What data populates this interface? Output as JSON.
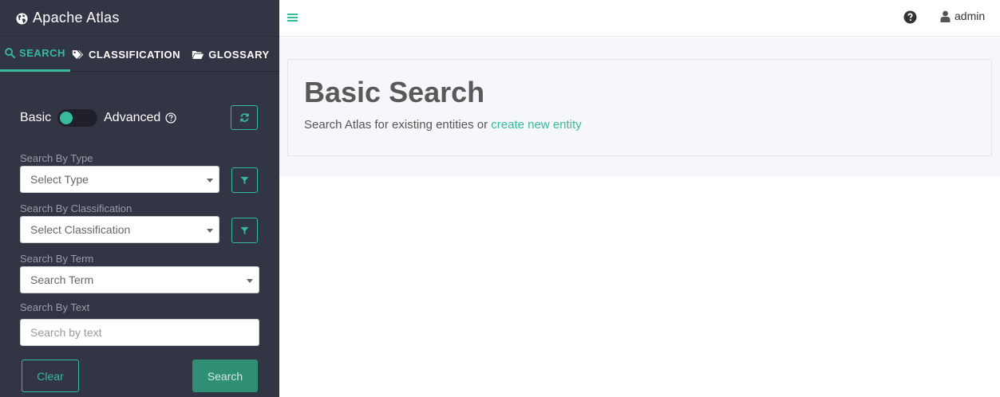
{
  "brand": {
    "title": "Apache Atlas"
  },
  "tabs": [
    {
      "label": "SEARCH",
      "active": true
    },
    {
      "label": "CLASSIFICATION",
      "active": false
    },
    {
      "label": "GLOSSARY",
      "active": false
    }
  ],
  "toggle": {
    "left_label": "Basic",
    "right_label": "Advanced"
  },
  "fields": {
    "type": {
      "label": "Search By Type",
      "placeholder": "Select Type"
    },
    "classification": {
      "label": "Search By Classification",
      "placeholder": "Select Classification"
    },
    "term": {
      "label": "Search By Term",
      "placeholder": "Search Term"
    },
    "text": {
      "label": "Search By Text",
      "placeholder": "Search by text"
    }
  },
  "buttons": {
    "clear": "Clear",
    "search": "Search"
  },
  "topbar": {
    "user": "admin"
  },
  "main": {
    "title": "Basic Search",
    "description": "Search Atlas for existing entities or ",
    "link": "create new entity"
  },
  "colors": {
    "accent": "#38bb9b",
    "sidebar": "#323544",
    "search_button": "#2e8f75"
  }
}
